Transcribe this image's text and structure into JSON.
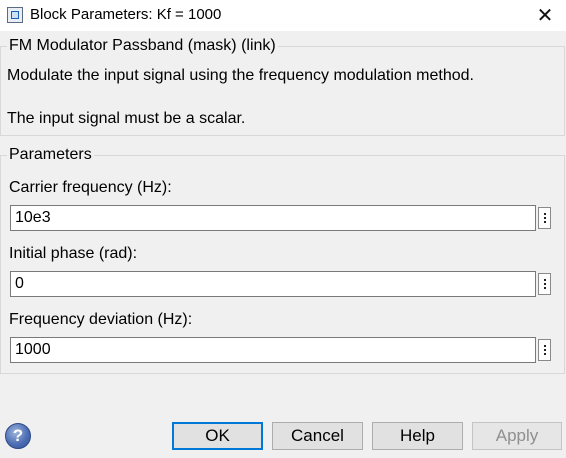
{
  "window": {
    "title": "Block Parameters: Kf = 1000",
    "icon": "simulink-block-icon",
    "close_icon": "close-icon"
  },
  "mask_section": {
    "legend": "FM Modulator Passband (mask) (link)",
    "description_1": "Modulate the input signal using the frequency modulation method.",
    "description_2": "The input signal must be a scalar."
  },
  "parameters": {
    "legend": "Parameters",
    "fields": [
      {
        "label": "Carrier frequency (Hz):",
        "value": "10e3"
      },
      {
        "label": "Initial phase (rad):",
        "value": "0"
      },
      {
        "label": "Frequency deviation (Hz):",
        "value": "1000"
      }
    ]
  },
  "buttons": {
    "help_icon": "help-icon",
    "ok": "OK",
    "cancel": "Cancel",
    "help": "Help",
    "apply": "Apply"
  }
}
